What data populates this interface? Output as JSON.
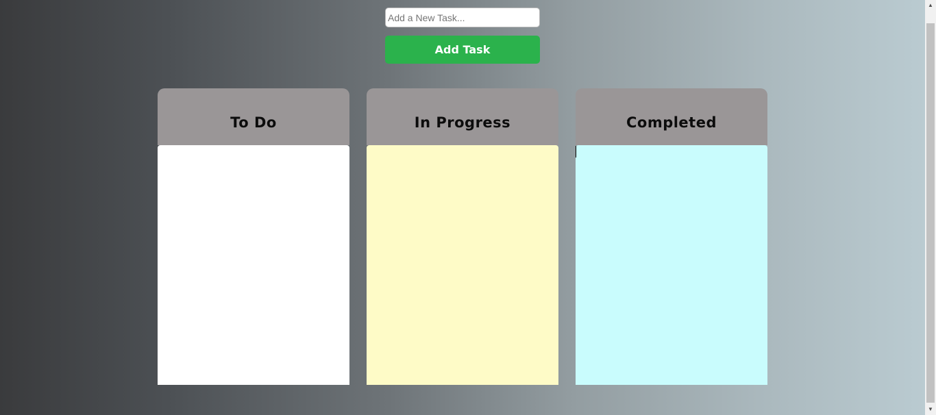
{
  "task_input": {
    "placeholder": "Add a New Task...",
    "value": ""
  },
  "add_button": {
    "label": "Add Task"
  },
  "columns": [
    {
      "title": "To Do",
      "body_color": "#ffffff"
    },
    {
      "title": "In Progress",
      "body_color": "#fefbc7"
    },
    {
      "title": "Completed",
      "body_color": "#c9fcfd"
    }
  ],
  "colors": {
    "accent": "#2bb24c",
    "header": "#9a9697"
  },
  "icons": {
    "scroll_up": "arrow-up-icon",
    "scroll_down": "arrow-down-icon"
  }
}
